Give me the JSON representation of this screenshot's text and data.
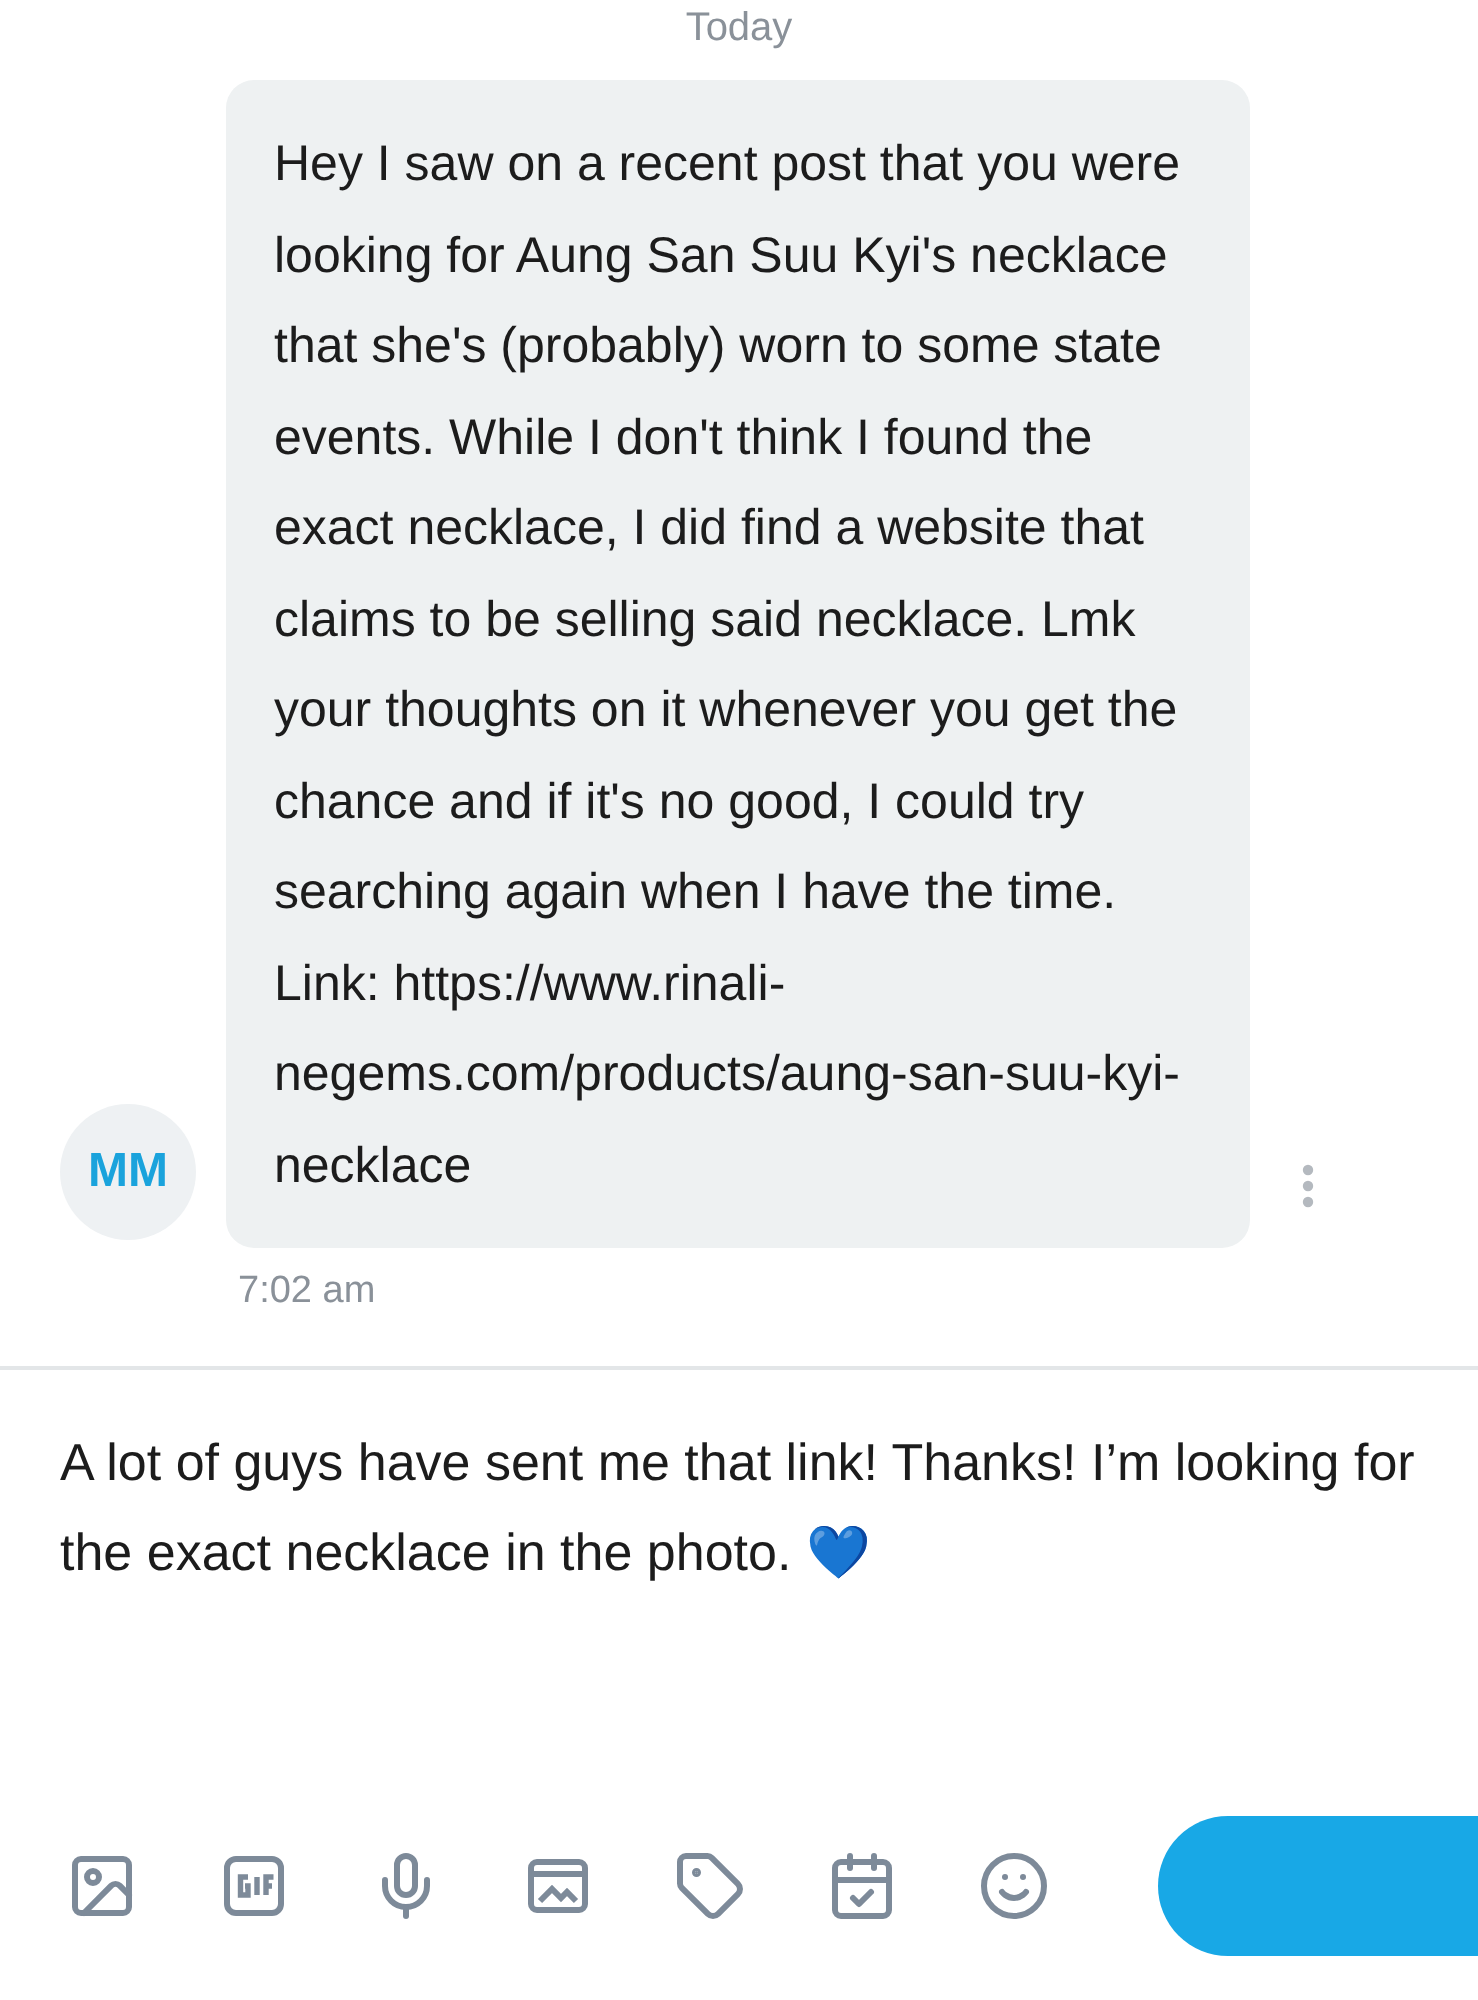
{
  "date_label": "Today",
  "message": {
    "avatar_initials": "MM",
    "text": "Hey I saw on a recent post that you were looking for Aung San Suu Kyi's necklace that she's (probably) worn to some state events. While I don't think I found the exact necklace, I did find a website that claims to be selling said necklace. Lmk your thoughts on it whenever you get the chance and if it's no good, I could try searching again when I have the time. Link: https://www.rinali-negems.com/products/aung-san-suu-kyi-necklace",
    "time": "7:02 am"
  },
  "composer": {
    "value": "A lot of guys have sent me that link! Thanks! I’m looking for the exact necklace in the photo. 💙"
  },
  "toolbar": [
    {
      "kind": "image"
    },
    {
      "kind": "gif"
    },
    {
      "kind": "mic"
    },
    {
      "kind": "gallery"
    },
    {
      "kind": "tag"
    },
    {
      "kind": "calendar"
    },
    {
      "kind": "emoji"
    }
  ]
}
